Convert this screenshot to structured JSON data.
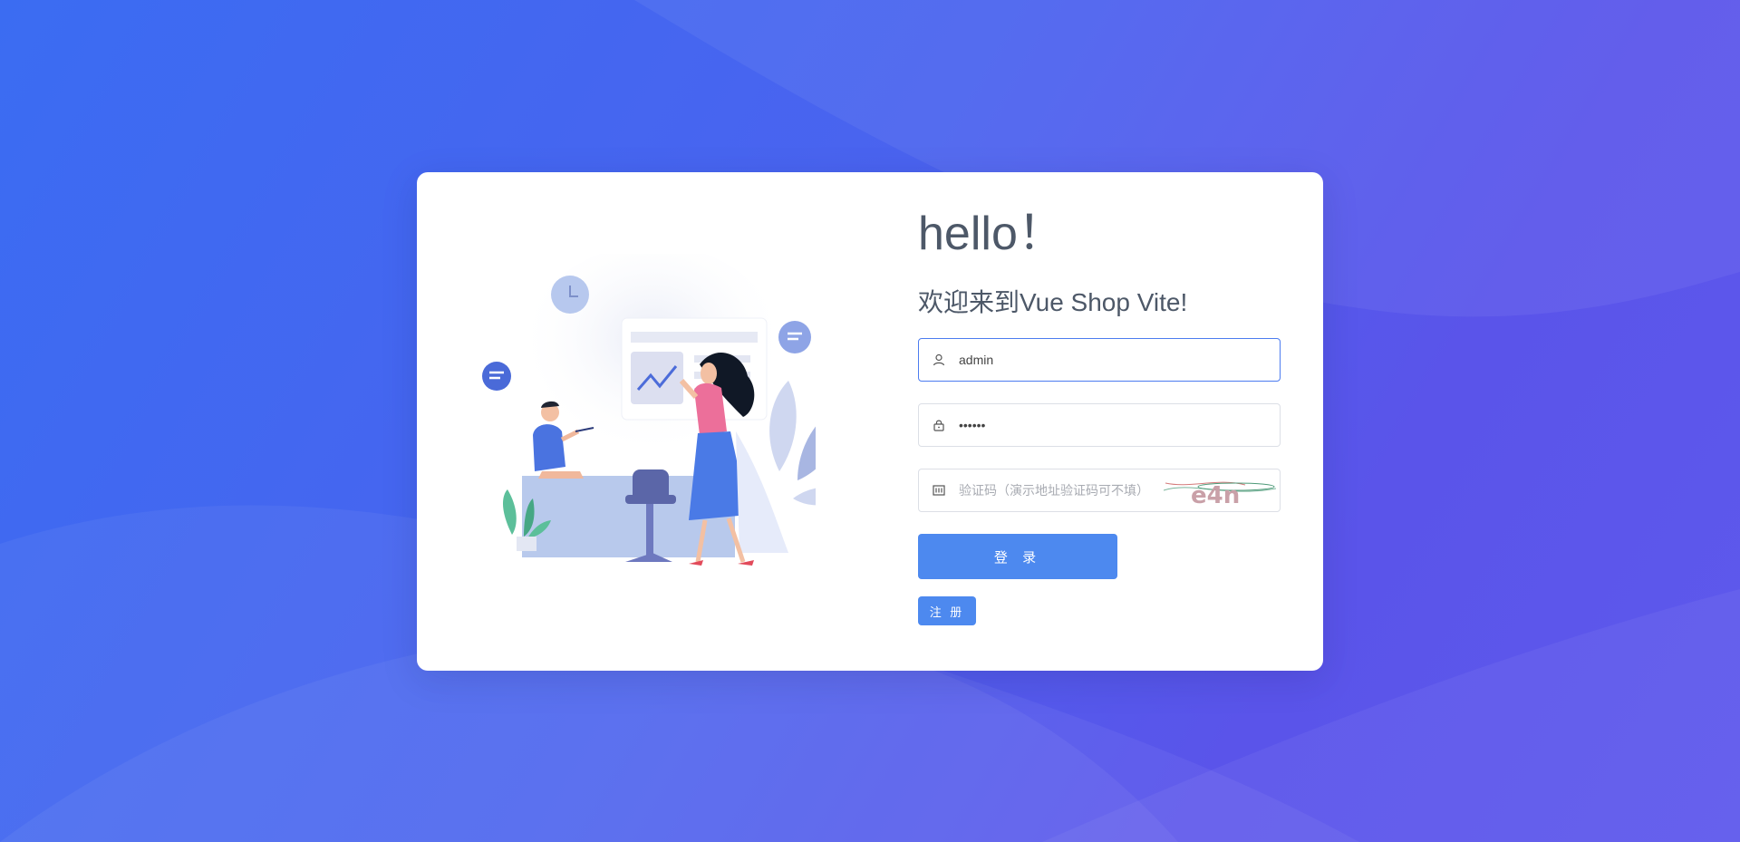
{
  "login": {
    "greeting": "hello！",
    "welcome": "欢迎来到Vue Shop Vite!",
    "username": {
      "value": "admin",
      "icon": "user-icon"
    },
    "password": {
      "value": "••••••",
      "icon": "lock-icon"
    },
    "captcha": {
      "placeholder": "验证码（演示地址验证码可不填）",
      "icon": "captcha-icon",
      "image_text": "e4n"
    },
    "login_button": "登 录",
    "register_button": "注 册"
  },
  "colors": {
    "primary": "#4d89ef",
    "input_focus_border": "#4c7cf0",
    "text": "#4d5868"
  }
}
